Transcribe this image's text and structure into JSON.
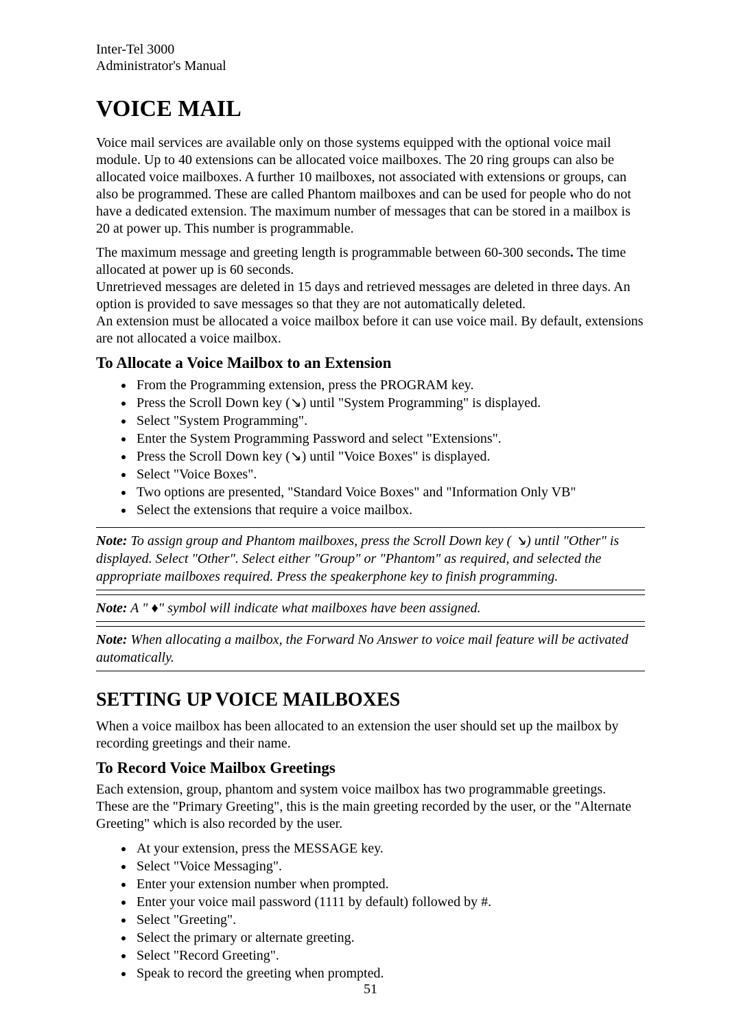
{
  "header": {
    "line1": "Inter-Tel 3000",
    "line2": "Administrator's Manual"
  },
  "title": "VOICE MAIL",
  "intro_para1": "Voice mail services are available only on those systems equipped with the optional voice mail module. Up to 40 extensions can be allocated voice mailboxes. The 20 ring groups can also be allocated voice mailboxes. A further 10 mailboxes, not associated with extensions or groups, can also be programmed. These are called Phantom mailboxes and can be used for people who do not have a dedicated extension. The maximum number of messages that can be stored in a mailbox is 20 at power up. This number is programmable.",
  "intro_para2_a": "The maximum message and greeting length is programmable between 60-300 seconds",
  "intro_para2_a_period": ".",
  "intro_para2_b": " The time allocated at power up is 60 seconds.",
  "intro_para3": "Unretrieved messages are deleted in 15 days and retrieved messages are deleted in three days. An option is provided to save messages so that they are not automatically deleted.",
  "intro_para4": "An extension must be allocated a voice mailbox before it can use voice mail.   By default, extensions are not allocated a voice mailbox.",
  "section1_heading": "To Allocate a Voice Mailbox to an Extension",
  "allocate_bullets": [
    "From the Programming extension, press the PROGRAM key.",
    "Press the Scroll Down key (↘) until \"System Programming\" is displayed.",
    "Select \"System Programming\".",
    "Enter the System Programming Password and select \"Extensions\".",
    "Press the Scroll Down key (↘) until \"Voice Boxes\" is displayed.",
    "Select \"Voice Boxes\".",
    "Two options are presented, \"Standard Voice Boxes\" and \"Information Only VB\"",
    "Select the extensions that require a voice mailbox."
  ],
  "note_label": "Note:",
  "note1": " To assign group and Phantom mailboxes, press the Scroll Down key ( ↘) until \"Other\" is displayed. Select \"Other\". Select either \"Group\" or \"Phantom\" as required, and selected the appropriate mailboxes required. Press the speakerphone key to finish programming.",
  "note2_a": " A \" ",
  "note2_diamond": "♦",
  "note2_b": "\" symbol will indicate what mailboxes have been assigned.",
  "note3": " When allocating a mailbox, the Forward No Answer to voice mail feature will be activated automatically.",
  "section2_heading": "SETTING UP VOICE MAILBOXES",
  "section2_para": "When a voice mailbox has been allocated to an extension the user should set up the mailbox by recording greetings and  their name.",
  "section3_heading": "To Record Voice Mailbox Greetings",
  "section3_para1": "Each extension, group, phantom and system voice mailbox has two programmable greetings.",
  "section3_para2": "These are  the \"Primary Greeting\", this is the main greeting recorded by the user, or the \"Alternate Greeting\" which is also recorded by the user.",
  "record_bullets": [
    "At your extension, press the MESSAGE key.",
    "Select \"Voice Messaging\".",
    "Enter your extension number when prompted.",
    "Enter your voice mail password (1111 by default) followed by #.",
    "Select \"Greeting\".",
    "Select the primary or alternate greeting.",
    "Select \"Record Greeting\".",
    "Speak to record the greeting when prompted."
  ],
  "page_number": "51"
}
